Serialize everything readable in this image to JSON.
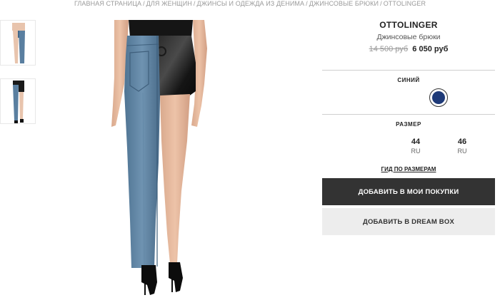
{
  "breadcrumb": {
    "items": [
      "ГЛАВНАЯ СТРАНИЦА",
      "ДЛЯ ЖЕНЩИН",
      "ДЖИНСЫ И ОДЕЖДА ИЗ ДЕНИМА",
      "ДЖИНСОВЫЕ БРЮКИ",
      "OTTOLINGER"
    ],
    "separator": "/"
  },
  "product": {
    "brand": "OTTOLINGER",
    "type": "Джинсовые брюки",
    "old_price": "14 500 руб",
    "new_price": "6 050 руб"
  },
  "color": {
    "label": "СИНИЙ",
    "swatch_hex": "#1e3a78"
  },
  "size": {
    "label": "РАЗМЕР",
    "options": [
      {
        "value": "44",
        "unit": "RU"
      },
      {
        "value": "46",
        "unit": "RU"
      }
    ],
    "guide_link": "ГИД ПО РАЗМЕРАМ"
  },
  "buttons": {
    "add_to_cart": "ДОБАВИТЬ В МОИ ПОКУПКИ",
    "add_to_dreambox": "ДОБАВИТЬ В DREAM BOX"
  },
  "colors": {
    "cart_button_bg": "#333333",
    "dream_button_bg": "#ededed",
    "denim": "#5a7fa0",
    "satin_black": "#1a1a1a"
  }
}
